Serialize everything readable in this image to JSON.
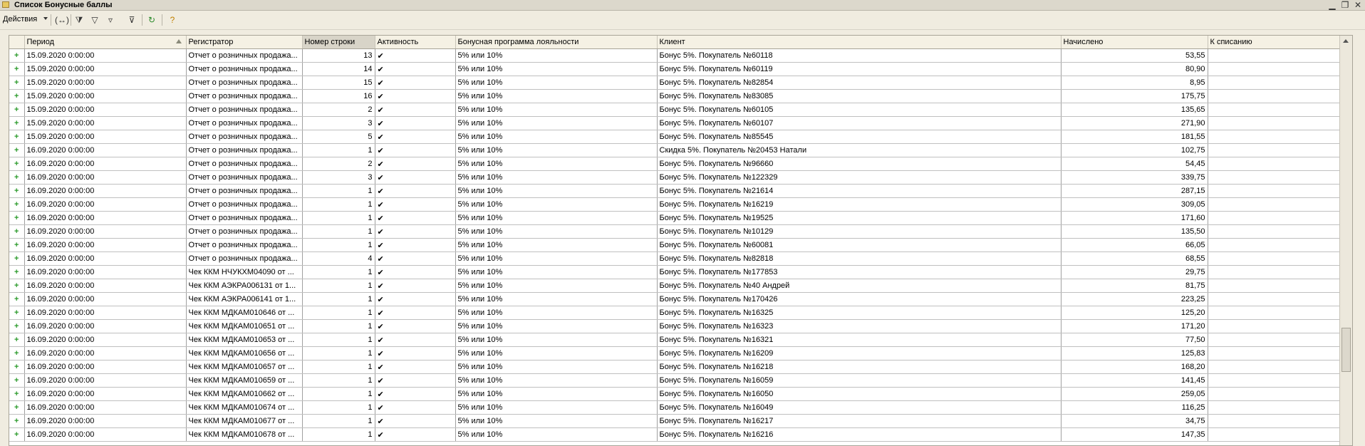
{
  "window": {
    "title": "Список Бонусные баллы",
    "controls": [
      "minimize-icon",
      "restore-icon",
      "close-icon"
    ]
  },
  "toolbar": {
    "actions_label": "Действия",
    "icons": [
      "parentheses-icon",
      "filter-settings-icon",
      "filter-by-value-icon",
      "filter-history-icon",
      "clear-filter-icon",
      "refresh-icon",
      "help-icon"
    ]
  },
  "grid": {
    "columns": [
      "",
      "Период",
      "Регистратор",
      "Номер строки",
      "Активность",
      "Бонусная программа лояльности",
      "Клиент",
      "Начислено",
      "К списанию"
    ],
    "rows": [
      [
        "+",
        "15.09.2020 0:00:00",
        "Отчет о розничных продажа...",
        "13",
        "✔",
        "5% или 10%",
        "Бонус 5%. Покупатель №60118",
        "53,55",
        ""
      ],
      [
        "+",
        "15.09.2020 0:00:00",
        "Отчет о розничных продажа...",
        "14",
        "✔",
        "5% или 10%",
        "Бонус 5%. Покупатель №60119",
        "80,90",
        ""
      ],
      [
        "+",
        "15.09.2020 0:00:00",
        "Отчет о розничных продажа...",
        "15",
        "✔",
        "5% или 10%",
        "Бонус 5%. Покупатель №82854",
        "8,95",
        ""
      ],
      [
        "+",
        "15.09.2020 0:00:00",
        "Отчет о розничных продажа...",
        "16",
        "✔",
        "5% или 10%",
        "Бонус 5%. Покупатель №83085",
        "175,75",
        ""
      ],
      [
        "+",
        "15.09.2020 0:00:00",
        "Отчет о розничных продажа...",
        "2",
        "✔",
        "5% или 10%",
        "Бонус 5%. Покупатель №60105",
        "135,65",
        ""
      ],
      [
        "+",
        "15.09.2020 0:00:00",
        "Отчет о розничных продажа...",
        "3",
        "✔",
        "5% или 10%",
        "Бонус 5%. Покупатель №60107",
        "271,90",
        ""
      ],
      [
        "+",
        "15.09.2020 0:00:00",
        "Отчет о розничных продажа...",
        "5",
        "✔",
        "5% или 10%",
        "Бонус 5%. Покупатель №85545",
        "181,55",
        ""
      ],
      [
        "+",
        "16.09.2020 0:00:00",
        "Отчет о розничных продажа...",
        "1",
        "✔",
        "5% или 10%",
        "Скидка 5%. Покупатель №20453 Натали",
        "102,75",
        ""
      ],
      [
        "+",
        "16.09.2020 0:00:00",
        "Отчет о розничных продажа...",
        "2",
        "✔",
        "5% или 10%",
        "Бонус 5%. Покупатель №96660",
        "54,45",
        ""
      ],
      [
        "+",
        "16.09.2020 0:00:00",
        "Отчет о розничных продажа...",
        "3",
        "✔",
        "5% или 10%",
        "Бонус 5%. Покупатель №122329",
        "339,75",
        ""
      ],
      [
        "+",
        "16.09.2020 0:00:00",
        "Отчет о розничных продажа...",
        "1",
        "✔",
        "5% или 10%",
        "Бонус 5%. Покупатель №21614",
        "287,15",
        ""
      ],
      [
        "+",
        "16.09.2020 0:00:00",
        "Отчет о розничных продажа...",
        "1",
        "✔",
        "5% или 10%",
        "Бонус 5%. Покупатель №16219",
        "309,05",
        ""
      ],
      [
        "+",
        "16.09.2020 0:00:00",
        "Отчет о розничных продажа...",
        "1",
        "✔",
        "5% или 10%",
        "Бонус 5%. Покупатель №19525",
        "171,60",
        ""
      ],
      [
        "+",
        "16.09.2020 0:00:00",
        "Отчет о розничных продажа...",
        "1",
        "✔",
        "5% или 10%",
        "Бонус 5%. Покупатель №10129",
        "135,50",
        ""
      ],
      [
        "+",
        "16.09.2020 0:00:00",
        "Отчет о розничных продажа...",
        "1",
        "✔",
        "5% или 10%",
        "Бонус 5%. Покупатель №60081",
        "66,05",
        ""
      ],
      [
        "+",
        "16.09.2020 0:00:00",
        "Отчет о розничных продажа...",
        "4",
        "✔",
        "5% или 10%",
        "Бонус 5%. Покупатель №82818",
        "68,55",
        ""
      ],
      [
        "+",
        "16.09.2020 0:00:00",
        "Чек ККМ НЧУКХМ04090 от ...",
        "1",
        "✔",
        "5% или 10%",
        "Бонус 5%. Покупатель №177853",
        "29,75",
        ""
      ],
      [
        "+",
        "16.09.2020 0:00:00",
        "Чек ККМ АЭКРА006131 от 1...",
        "1",
        "✔",
        "5% или 10%",
        "Бонус 5%. Покупатель №40 Андрей",
        "81,75",
        ""
      ],
      [
        "+",
        "16.09.2020 0:00:00",
        "Чек ККМ АЭКРА006141 от 1...",
        "1",
        "✔",
        "5% или 10%",
        "Бонус 5%. Покупатель №170426",
        "223,25",
        ""
      ],
      [
        "+",
        "16.09.2020 0:00:00",
        "Чек ККМ МДКАМ010646 от ...",
        "1",
        "✔",
        "5% или 10%",
        "Бонус 5%. Покупатель №16325",
        "125,20",
        ""
      ],
      [
        "+",
        "16.09.2020 0:00:00",
        "Чек ККМ МДКАМ010651 от ...",
        "1",
        "✔",
        "5% или 10%",
        "Бонус 5%. Покупатель №16323",
        "171,20",
        ""
      ],
      [
        "+",
        "16.09.2020 0:00:00",
        "Чек ККМ МДКАМ010653 от ...",
        "1",
        "✔",
        "5% или 10%",
        "Бонус 5%. Покупатель №16321",
        "77,50",
        ""
      ],
      [
        "+",
        "16.09.2020 0:00:00",
        "Чек ККМ МДКАМ010656 от ...",
        "1",
        "✔",
        "5% или 10%",
        "Бонус 5%. Покупатель №16209",
        "125,83",
        ""
      ],
      [
        "+",
        "16.09.2020 0:00:00",
        "Чек ККМ МДКАМ010657 от ...",
        "1",
        "✔",
        "5% или 10%",
        "Бонус 5%. Покупатель №16218",
        "168,20",
        ""
      ],
      [
        "+",
        "16.09.2020 0:00:00",
        "Чек ККМ МДКАМ010659 от ...",
        "1",
        "✔",
        "5% или 10%",
        "Бонус 5%. Покупатель №16059",
        "141,45",
        ""
      ],
      [
        "+",
        "16.09.2020 0:00:00",
        "Чек ККМ МДКАМ010662 от ...",
        "1",
        "✔",
        "5% или 10%",
        "Бонус 5%. Покупатель №16050",
        "259,05",
        ""
      ],
      [
        "+",
        "16.09.2020 0:00:00",
        "Чек ККМ МДКАМ010674 от ...",
        "1",
        "✔",
        "5% или 10%",
        "Бонус 5%. Покупатель №16049",
        "116,25",
        ""
      ],
      [
        "+",
        "16.09.2020 0:00:00",
        "Чек ККМ МДКАМ010677 от ...",
        "1",
        "✔",
        "5% или 10%",
        "Бонус 5%. Покупатель №16217",
        "34,75",
        ""
      ],
      [
        "+",
        "16.09.2020 0:00:00",
        "Чек ККМ МДКАМ010678 от ...",
        "1",
        "✔",
        "5% или 10%",
        "Бонус 5%. Покупатель №16216",
        "147,35",
        ""
      ]
    ]
  }
}
